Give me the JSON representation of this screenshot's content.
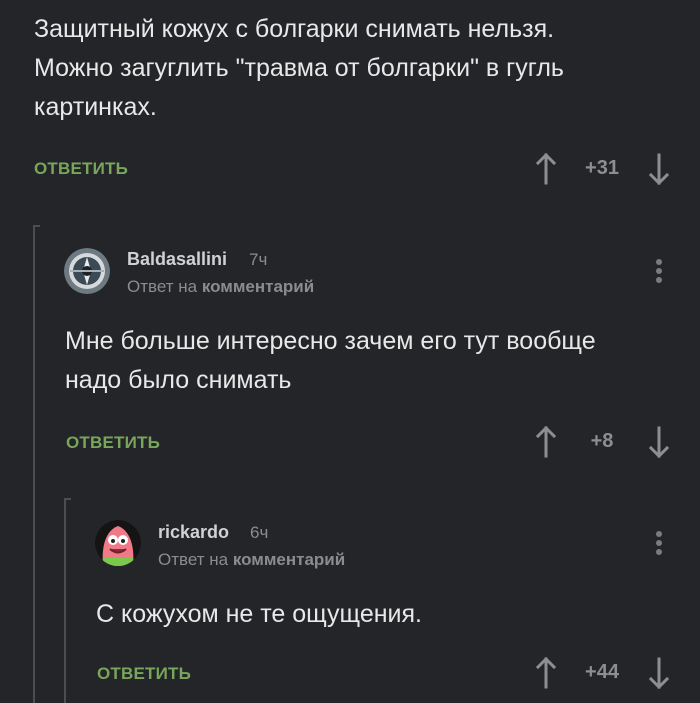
{
  "comment0": {
    "lines": [
      "Защитный кожух с болгарки снимать нельзя.",
      "Можно загуглить \"травма от болгарки\" в гугль",
      "картинках."
    ],
    "reply_label": "ответить",
    "score": "+31"
  },
  "comment1": {
    "author": "Baldasallini",
    "time": "7ч",
    "reply_prefix": "Ответ на",
    "reply_link": "комментарий",
    "lines": [
      "Мне больше интересно зачем его тут вообще",
      "надо было снимать"
    ],
    "reply_label": "ответить",
    "score": "+8"
  },
  "comment2": {
    "author": "rickardo",
    "time": "6ч",
    "reply_prefix": "Ответ на",
    "reply_link": "комментарий",
    "lines": [
      "С кожухом не те ощущения."
    ],
    "reply_label": "ответить",
    "score": "+44"
  },
  "colors": {
    "background": "#232528",
    "reply_green": "#78a65b",
    "muted": "#8a8c8f"
  },
  "icons": [
    "upvote-arrow-icon",
    "downvote-arrow-icon",
    "more-dots-icon"
  ]
}
